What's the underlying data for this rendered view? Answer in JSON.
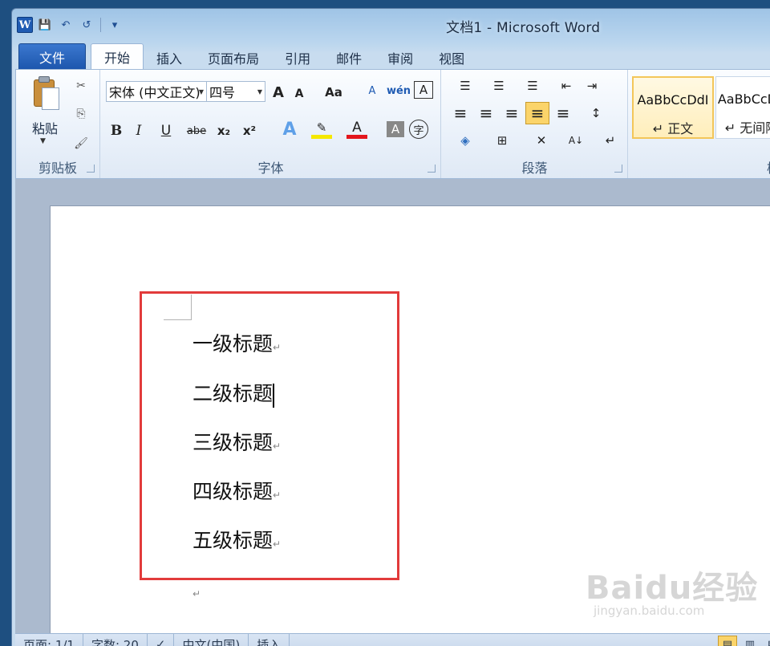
{
  "window": {
    "title": "文档1 - Microsoft Word"
  },
  "qat": {
    "app_icon": "W",
    "save_icon": "💾",
    "undo_icon": "↶",
    "redo_icon": "↺",
    "customize_icon": "▾"
  },
  "tabs": [
    {
      "label": "文件"
    },
    {
      "label": "开始"
    },
    {
      "label": "插入"
    },
    {
      "label": "页面布局"
    },
    {
      "label": "引用"
    },
    {
      "label": "邮件"
    },
    {
      "label": "审阅"
    },
    {
      "label": "视图"
    }
  ],
  "ribbon": {
    "clipboard": {
      "label": "剪贴板",
      "paste_label": "粘贴",
      "cut_icon": "✂",
      "copy_icon": "⎘",
      "format_painter_icon": "🖌"
    },
    "font": {
      "label": "字体",
      "font_name": "宋体 (中文正文)",
      "font_size": "四号",
      "grow_font": "A",
      "shrink_font": "A",
      "change_case": "Aa",
      "clear_format": "A",
      "phonetic": "wén",
      "char_border": "A",
      "bold": "B",
      "italic": "I",
      "underline": "U",
      "strikethrough": "abe",
      "subscript": "x₂",
      "superscript": "x²",
      "text_effects": "A",
      "highlight": "✎",
      "font_color": "A",
      "char_shading": "A",
      "enclose": "字"
    },
    "paragraph": {
      "label": "段落",
      "bullets_icon": "☰",
      "numbering_icon": "☰",
      "multilevel_icon": "☰",
      "decrease_indent_icon": "⇤",
      "increase_indent_icon": "⇥",
      "align_left_icon": "≡",
      "center_icon": "≡",
      "align_right_icon": "≡",
      "justify_icon": "≡",
      "distributed_icon": "≡",
      "line_spacing_icon": "↕",
      "shading_icon": "◈",
      "borders_icon": "⊞",
      "chinese_layout_icon": "✕",
      "sort_icon": "A↓",
      "show_marks_icon": "↵"
    },
    "styles": {
      "label": "样",
      "items": [
        {
          "sample": "AaBbCcDdI",
          "name": "↵ 正文"
        },
        {
          "sample": "AaBbCcDd",
          "name": "↵ 无间隔"
        }
      ]
    }
  },
  "document": {
    "headings": [
      "一级标题",
      "二级标题",
      "三级标题",
      "四级标题",
      "五级标题"
    ],
    "paragraph_mark": "↵"
  },
  "status": {
    "page": "页面: 1/1",
    "words": "字数: 20",
    "language": "中文(中国)",
    "mode": "插入"
  },
  "watermark": {
    "logo": "Baidu经验",
    "url": "jingyan.baidu.com"
  }
}
